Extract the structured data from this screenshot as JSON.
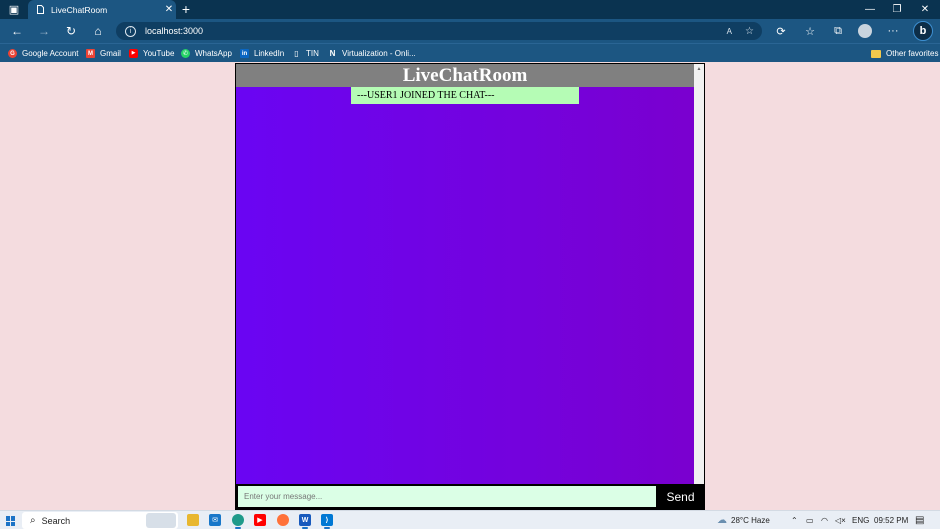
{
  "browser": {
    "tab_title": "LiveChatRoom",
    "tab_close": "✕",
    "new_tab": "+",
    "url": "localhost:3000",
    "read_aloud": "A",
    "favorites_label": "Other favorites"
  },
  "bookmarks": [
    {
      "label": "Google Account",
      "icon": "google-icon",
      "color": "#ea4335",
      "glyph": "G"
    },
    {
      "label": "Gmail",
      "icon": "gmail-icon",
      "color": "#ea4335",
      "glyph": "M"
    },
    {
      "label": "YouTube",
      "icon": "youtube-icon",
      "color": "#ff0000",
      "glyph": "▶"
    },
    {
      "label": "WhatsApp",
      "icon": "whatsapp-icon",
      "color": "#25d366",
      "glyph": "✆"
    },
    {
      "label": "LinkedIn",
      "icon": "linkedin-icon",
      "color": "#0a66c2",
      "glyph": "in"
    },
    {
      "label": "TIN",
      "icon": "page-icon",
      "color": "#1c5682",
      "glyph": "▯"
    },
    {
      "label": "Virtualization - Onli...",
      "icon": "notion-icon",
      "color": "#1c5682",
      "glyph": "N"
    }
  ],
  "chat": {
    "title": "LiveChatRoom",
    "messages": [
      {
        "type": "system",
        "text": "---USER1 JOINED THE CHAT---"
      }
    ],
    "input_placeholder": "Enter your message...",
    "send_label": "Send"
  },
  "taskbar": {
    "search_label": "Search",
    "weather": "28°C Haze",
    "language": "ENG",
    "time": "09:52 PM"
  },
  "colors": {
    "page_background": "#f4dcdf",
    "header_background": "#808080",
    "chat_background_start": "#6a05f3",
    "chat_background_end": "#7a00cf",
    "system_message_background": "#b5fcb5",
    "input_background": "#dbffe6",
    "send_button_background": "#000000"
  }
}
